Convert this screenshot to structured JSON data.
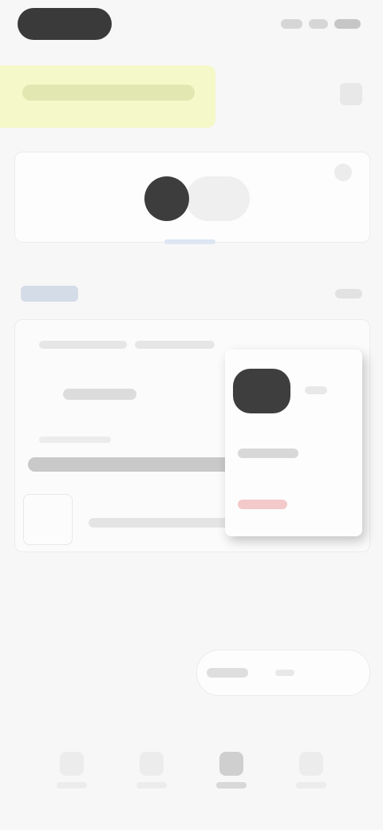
{
  "colors": {
    "background": "#f7f7f7",
    "header_highlight": "#f5f8c8",
    "card": "#fdfdfd",
    "dark": "#3d3d3d",
    "accent_link": "#d4dce8",
    "danger": "#f3c9c9"
  },
  "status_bar": {
    "time": "",
    "icons": [
      "signal-icon",
      "wifi-icon",
      "battery-icon"
    ]
  },
  "header": {
    "title": "",
    "action_icon": "menu-icon"
  },
  "profile": {
    "avatar_icon": "avatar",
    "corner_icon": "more-icon"
  },
  "section": {
    "title": "",
    "link": ""
  },
  "item": {
    "name": "",
    "caption": "",
    "progress": 0.95
  },
  "popup": {
    "edit_label": "",
    "delete_label": ""
  },
  "pill": {
    "label": ""
  },
  "tabs": [
    {
      "label": "",
      "icon": "home-icon"
    },
    {
      "label": "",
      "icon": "list-icon"
    },
    {
      "label": "",
      "icon": "calendar-icon"
    },
    {
      "label": "",
      "icon": "profile-icon"
    }
  ]
}
